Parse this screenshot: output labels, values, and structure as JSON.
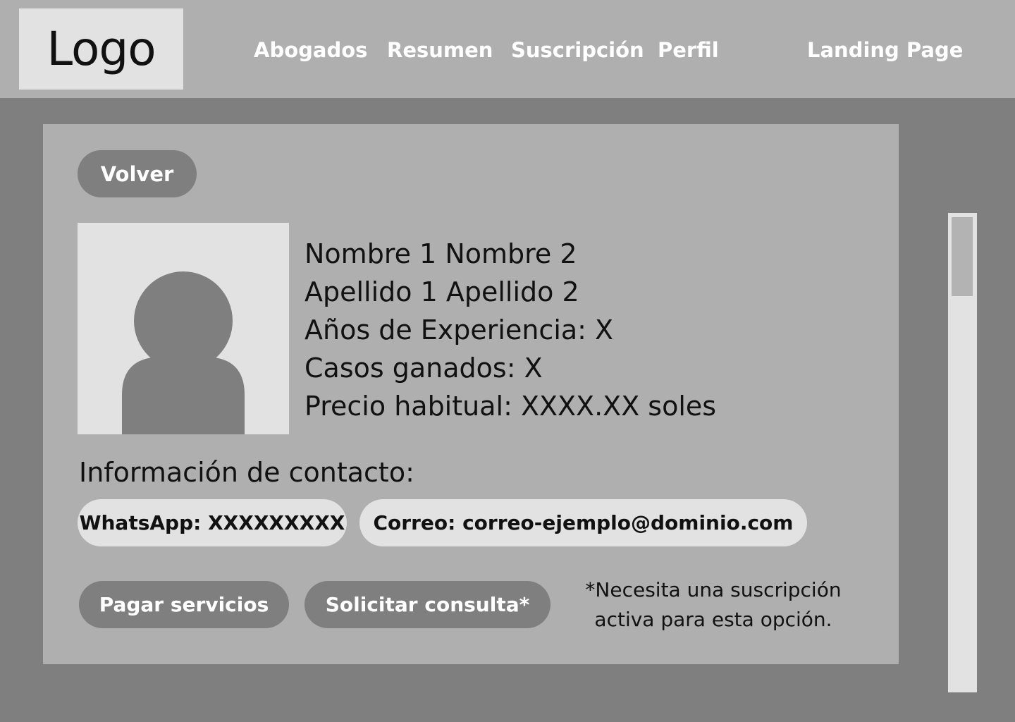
{
  "header": {
    "logo_text": "Logo",
    "nav": [
      {
        "label": "Abogados"
      },
      {
        "label": "Resumen"
      },
      {
        "label": "Suscripción"
      },
      {
        "label": "Perfil"
      },
      {
        "label": "Landing Page"
      }
    ]
  },
  "profile": {
    "back_label": "Volver",
    "avatar_icon": "user-silhouette-icon",
    "lines": [
      "Nombre 1 Nombre 2",
      "Apellido 1 Apellido 2",
      "Años de Experiencia: X",
      "Casos ganados: X",
      "Precio habitual: XXXX.XX soles"
    ]
  },
  "contact": {
    "title": "Información de contacto:",
    "whatsapp": "WhatsApp: XXXXXXXXX",
    "email": "Correo: correo-ejemplo@dominio.com"
  },
  "actions": {
    "pay_label": "Pagar servicios",
    "consult_label": "Solicitar consulta*",
    "note_line1": "*Necesita una suscripción",
    "note_line2": "activa para esta opción."
  },
  "colors": {
    "background": "#7f7f7f",
    "panel": "#afafaf",
    "light": "#e2e2e2",
    "text": "#111111",
    "button_text": "#ffffff"
  }
}
